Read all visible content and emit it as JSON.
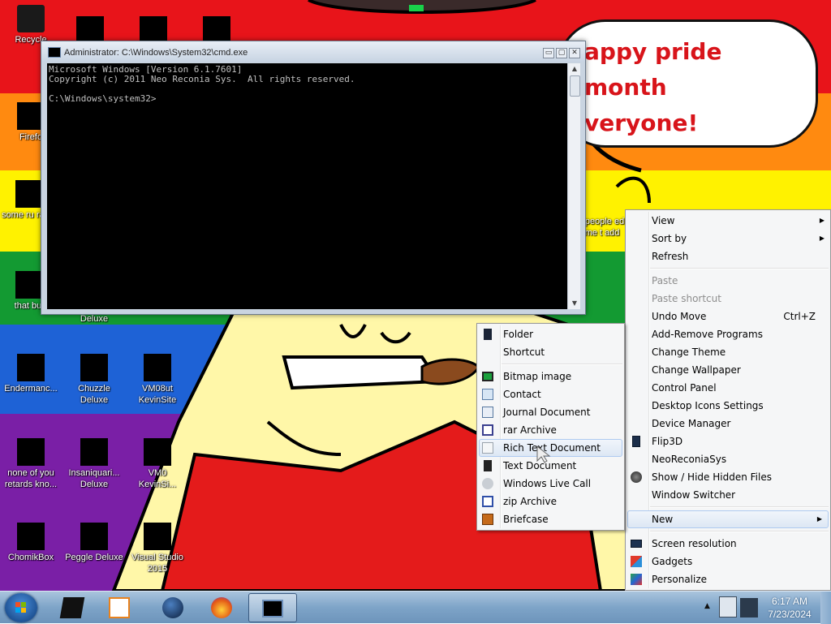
{
  "desktop": {
    "bubble_text": "appy pride month\nveryone!",
    "icons": [
      {
        "label": "Recycle",
        "glyph": "recycle-bin-icon"
      },
      {
        "label": "Firefo",
        "glyph": "firefox-icon"
      },
      {
        "label": "some ru ran a",
        "glyph": "folder-icon"
      },
      {
        "label": "that but",
        "glyph": "file-icon"
      },
      {
        "label": "Deluxe",
        "glyph": ""
      },
      {
        "label": "Endermanc...",
        "glyph": "app-icon"
      },
      {
        "label": "Chuzzle Deluxe",
        "glyph": "game-icon"
      },
      {
        "label": "VM08ut KevinSite",
        "glyph": "app-icon"
      },
      {
        "label": "none of you retards kno...",
        "glyph": "firefox-icon"
      },
      {
        "label": "Insaniquari... Deluxe",
        "glyph": "game-icon"
      },
      {
        "label": "VM0 KevinSi...",
        "glyph": "app-icon"
      },
      {
        "label": "ChomikBox",
        "glyph": "app-icon"
      },
      {
        "label": "Peggle Deluxe",
        "glyph": "game-icon"
      },
      {
        "label": "Visual Studio 2015",
        "glyph": "visual-studio-icon"
      },
      {
        "label": "t people ed me t add",
        "glyph": "file-icon"
      }
    ]
  },
  "cmd_window": {
    "title": "Administrator: C:\\Windows\\System32\\cmd.exe",
    "console_text": "Microsoft Windows [Version 6.1.7601]\nCopyright (c) 2011 Neo Reconia Sys.  All rights reserved.\n\nC:\\Windows\\system32>",
    "buttons": {
      "minimize": "▭",
      "maximize": "▢",
      "close": "✕"
    }
  },
  "context_menu": {
    "items": [
      {
        "label": "View",
        "submenu": true
      },
      {
        "label": "Sort by",
        "submenu": true
      },
      {
        "label": "Refresh"
      },
      {
        "separator": true
      },
      {
        "label": "Paste",
        "disabled": true
      },
      {
        "label": "Paste shortcut",
        "disabled": true
      },
      {
        "label": "Undo Move",
        "shortcut": "Ctrl+Z"
      },
      {
        "label": "Add-Remove Programs"
      },
      {
        "label": "Change Theme"
      },
      {
        "label": "Change Wallpaper"
      },
      {
        "label": "Control Panel"
      },
      {
        "label": "Desktop Icons Settings"
      },
      {
        "label": "Device Manager"
      },
      {
        "label": "Flip3D",
        "icon": "flip3d-icon"
      },
      {
        "label": "NeoReconiaSys"
      },
      {
        "label": "Show / Hide Hidden Files",
        "icon": "hidden-files-icon"
      },
      {
        "label": "Window Switcher"
      },
      {
        "separator": true
      },
      {
        "label": "New",
        "submenu": true,
        "highlighted": true
      },
      {
        "separator": true
      },
      {
        "label": "Screen resolution",
        "icon": "screen-resolution-icon"
      },
      {
        "label": "Gadgets",
        "icon": "gadgets-icon"
      },
      {
        "label": "Personalize",
        "icon": "personalize-icon"
      }
    ]
  },
  "new_submenu": {
    "items": [
      {
        "label": "Folder",
        "icon": "folder-icon"
      },
      {
        "label": "Shortcut",
        "icon": ""
      },
      {
        "separator": true
      },
      {
        "label": "Bitmap image",
        "icon": "bitmap-icon"
      },
      {
        "label": "Contact",
        "icon": "contact-icon"
      },
      {
        "label": "Journal Document",
        "icon": "journal-icon"
      },
      {
        "label": "rar Archive",
        "icon": "rar-icon"
      },
      {
        "label": "Rich Text Document",
        "icon": "rich-text-icon",
        "highlighted": true
      },
      {
        "label": "Text Document",
        "icon": "text-document-icon"
      },
      {
        "label": "Windows Live Call",
        "icon": "live-call-icon"
      },
      {
        "label": "zip Archive",
        "icon": "zip-icon"
      },
      {
        "label": "Briefcase",
        "icon": "briefcase-icon"
      }
    ]
  },
  "taskbar": {
    "items": [
      {
        "name": "command-prompt-app-icon",
        "active": false
      },
      {
        "name": "media-player-icon",
        "active": false
      },
      {
        "name": "globe-icon",
        "active": false
      },
      {
        "name": "firefox-icon",
        "active": false
      },
      {
        "name": "cmd-window-icon",
        "active": true
      }
    ],
    "clock_time": "6:17 AM",
    "clock_date": "7/23/2024"
  },
  "colors": {
    "stripe_red": "#e8141a",
    "stripe_orange": "#ff8a10",
    "stripe_yellow": "#fff200",
    "stripe_green": "#139a32",
    "stripe_blue": "#1e62d6",
    "stripe_purple": "#7a1fa6",
    "menu_highlight": "#dde7f4"
  }
}
